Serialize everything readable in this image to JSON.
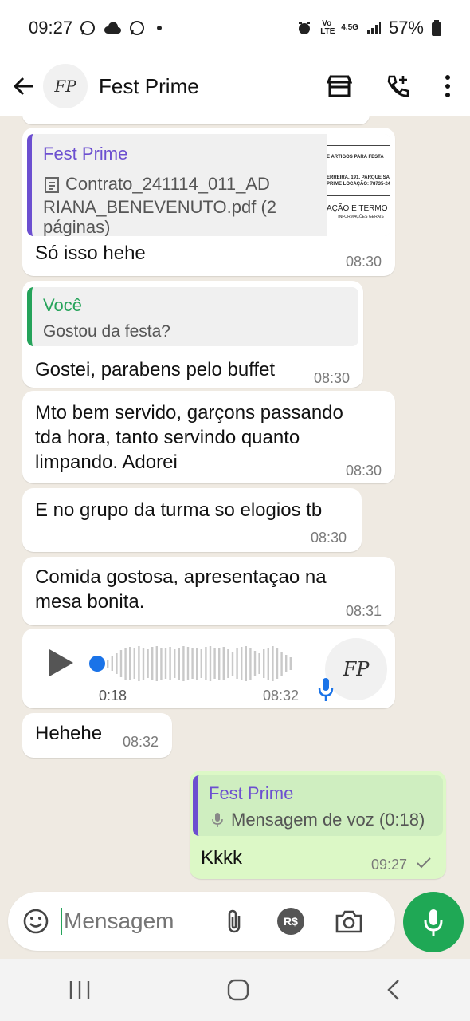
{
  "status_bar": {
    "time": "09:27",
    "network_top": "4.5G",
    "network_carrier": "Vo LTE",
    "battery": "57%"
  },
  "app_bar": {
    "contact_name": "Fest Prime",
    "avatar_text": "FP"
  },
  "messages": [
    {
      "id": "doc-reply",
      "quote_author": "Fest Prime",
      "quote_doc_line1": "Contrato_241114_011_AD",
      "quote_doc_line2": "RIANA_BENEVENUTO.pdf (2",
      "quote_doc_line3": "páginas)",
      "thumb_line1": "E ARTIGOS PARA FESTA",
      "thumb_line2": "ERREIRA, 191, PARQUE SAGRADA F",
      "thumb_line3": "PRIME LOCAÇÃO: 78735-244",
      "thumb_line4": "AÇÃO E TERMO DE",
      "thumb_line5": "INFORMAÇÕES GERAIS",
      "text": "Só isso hehe",
      "time": "08:30"
    },
    {
      "id": "you-reply",
      "quote_author": "Você",
      "quote_text": "Gostou da festa?",
      "text": "Gostei, parabens pelo buffet",
      "time": "08:30"
    },
    {
      "id": "msg-3",
      "text_line1": "Mto bem servido, garçons passando",
      "text_line2": "tda hora, tanto servindo quanto",
      "text_line3": "limpando. Adorei",
      "time": "08:30"
    },
    {
      "id": "msg-4",
      "text": "E no grupo da turma so elogios tb",
      "time": "08:30"
    },
    {
      "id": "msg-5",
      "text_line1": "Comida gostosa, apresentaçao na",
      "text_line2": "mesa bonita.",
      "time": "08:31"
    },
    {
      "id": "voice",
      "duration": "0:18",
      "time": "08:32",
      "progress": 0.0
    },
    {
      "id": "msg-7",
      "text": "Hehehe",
      "time": "08:32"
    },
    {
      "id": "outgoing",
      "quote_author": "Fest Prime",
      "quote_text": "Mensagem de voz (0:18)",
      "text": "Kkkk",
      "time": "09:27",
      "status": "sent"
    }
  ],
  "composer": {
    "placeholder": "Mensagem",
    "icons": [
      "emoji-icon",
      "attach-icon",
      "payment-icon",
      "camera-icon",
      "mic-icon"
    ],
    "payment_label": "R$"
  },
  "colors": {
    "accent_green": "#1fa855",
    "quote_purple": "#6c4fd0",
    "outgoing_bubble": "#dcf8c6",
    "chat_background": "#efeae2"
  }
}
